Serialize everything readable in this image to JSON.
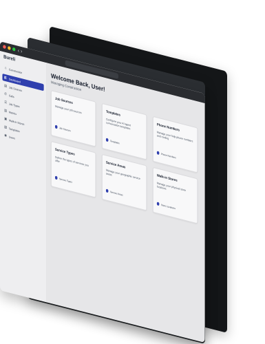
{
  "window": {
    "url": "",
    "nav_arrows": "‹ ›"
  },
  "sidebar": {
    "brand": "Bureli",
    "items": [
      {
        "label": "Construction",
        "icon": "home-icon",
        "glyph": "⌂",
        "active": false
      },
      {
        "label": "Dashboard",
        "icon": "dashboard-icon",
        "glyph": "◧",
        "active": true
      },
      {
        "label": "Job Sources",
        "icon": "sources-icon",
        "glyph": "▤",
        "active": false
      },
      {
        "label": "Calls",
        "icon": "phone-icon",
        "glyph": "✆",
        "active": false
      },
      {
        "label": "Job Types",
        "icon": "list-icon",
        "glyph": "☰",
        "active": false
      },
      {
        "label": "Metrics",
        "icon": "chart-icon",
        "glyph": "▥",
        "active": false
      },
      {
        "label": "Walk-In Stores",
        "icon": "store-icon",
        "glyph": "▣",
        "active": false
      },
      {
        "label": "Templates",
        "icon": "template-icon",
        "glyph": "▧",
        "active": false
      },
      {
        "label": "Users",
        "icon": "users-icon",
        "glyph": "◉",
        "active": false
      }
    ]
  },
  "main": {
    "welcome": "Welcome Back, User!",
    "subtitle": "Managing Construction",
    "cards": [
      {
        "title": "Job Sources",
        "desc": "Manage your job sources",
        "link": "Job Sources"
      },
      {
        "title": "Templates",
        "desc": "Configure your AI agent conversation templates",
        "link": "Templates"
      },
      {
        "title": "Phone Numbers",
        "desc": "Manage your help phone numbers and routing",
        "link": "Phone Numbers"
      },
      {
        "title": "Service Types",
        "desc": "Define the types of services you offer",
        "link": "Service Types"
      },
      {
        "title": "Service Areas",
        "desc": "Manage your geographic service areas",
        "link": "Service Areas"
      },
      {
        "title": "Walk-in Stores",
        "desc": "Manage your physical store locations",
        "link": "Store Locations"
      }
    ]
  }
}
